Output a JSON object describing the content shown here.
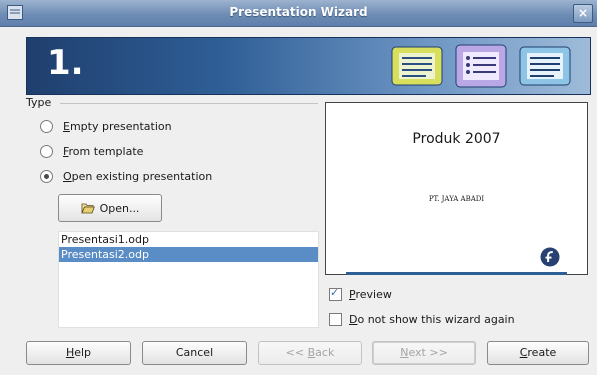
{
  "window": {
    "title": "Presentation Wizard",
    "close_glyph": "×",
    "accent": "#6f8db5"
  },
  "banner": {
    "step": "1."
  },
  "type_group": {
    "label": "Type",
    "options": [
      {
        "pre": "",
        "key": "E",
        "rest": "mpty presentation",
        "checked": false
      },
      {
        "pre": "",
        "key": "F",
        "rest": "rom template",
        "checked": false
      },
      {
        "pre": "",
        "key": "O",
        "rest": "pen existing presentation",
        "checked": true
      }
    ],
    "open_button": {
      "label": "Open...",
      "icon": "folder-open-icon"
    },
    "files": [
      {
        "name": "Presentasi1.odp",
        "selected": false
      },
      {
        "name": "Presentasi2.odp",
        "selected": true
      }
    ]
  },
  "preview_slide": {
    "title": "Produk 2007",
    "subtitle": "PT. JAYA ABADI",
    "logo_icon": "fedora-logo-icon"
  },
  "options": {
    "preview": {
      "key": "P",
      "rest": "review",
      "checked": true
    },
    "dont_show": {
      "key": "D",
      "rest": "o not show this wizard again",
      "checked": false
    }
  },
  "buttons": {
    "help": {
      "key": "H",
      "rest": "elp"
    },
    "cancel": "Cancel",
    "back": {
      "pre": "<< ",
      "key": "B",
      "rest": "ack"
    },
    "next": {
      "key": "N",
      "rest": "ext >>"
    },
    "create": {
      "key": "C",
      "rest": "reate"
    }
  }
}
